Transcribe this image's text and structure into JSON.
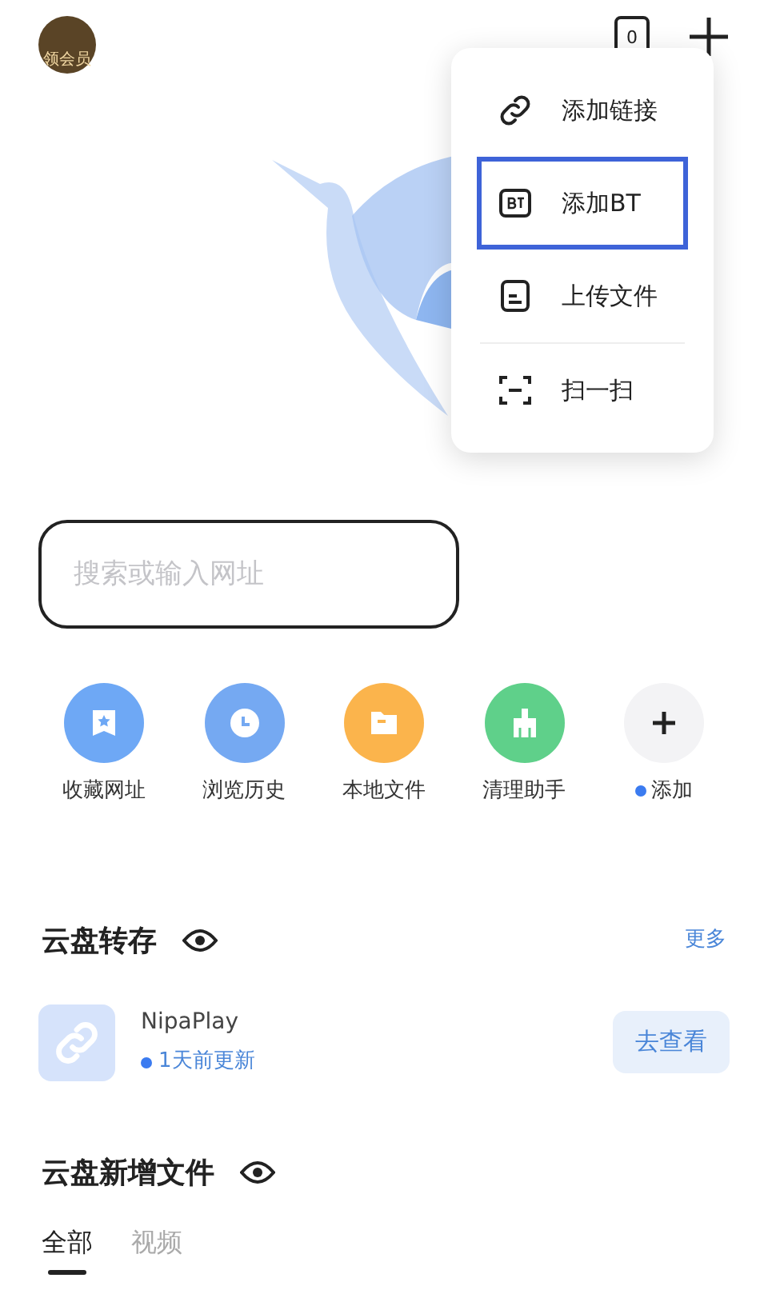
{
  "header": {
    "vip_badge": "领会员",
    "tab_count": "0"
  },
  "menu": {
    "items": [
      {
        "kind": "link",
        "label": "添加链接",
        "selected": false
      },
      {
        "kind": "bt",
        "label": "添加BT",
        "selected": true
      },
      {
        "kind": "file",
        "label": "上传文件",
        "selected": false
      },
      {
        "kind": "scan",
        "label": "扫一扫",
        "selected": false
      }
    ]
  },
  "search": {
    "placeholder": "搜索或输入网址"
  },
  "shortcuts": [
    {
      "kind": "bookmark",
      "label": "收藏网址",
      "color": "#6ea8f5",
      "badge_dot": false
    },
    {
      "kind": "history",
      "label": "浏览历史",
      "color": "#75a9f2",
      "badge_dot": false
    },
    {
      "kind": "folder",
      "label": "本地文件",
      "color": "#fbb44c",
      "badge_dot": false
    },
    {
      "kind": "clean",
      "label": "清理助手",
      "color": "#5fd08a",
      "badge_dot": false
    },
    {
      "kind": "add",
      "label": "添加",
      "color": "#f3f3f5",
      "badge_dot": true
    }
  ],
  "cloud_transfer": {
    "title": "云盘转存",
    "more": "更多",
    "items": [
      {
        "name": "NipaPlay",
        "updated": "1天前更新",
        "action": "去查看"
      }
    ]
  },
  "cloud_new_files": {
    "title": "云盘新增文件",
    "tabs": [
      {
        "label": "全部",
        "selected": true
      },
      {
        "label": "视频",
        "selected": false
      }
    ]
  }
}
